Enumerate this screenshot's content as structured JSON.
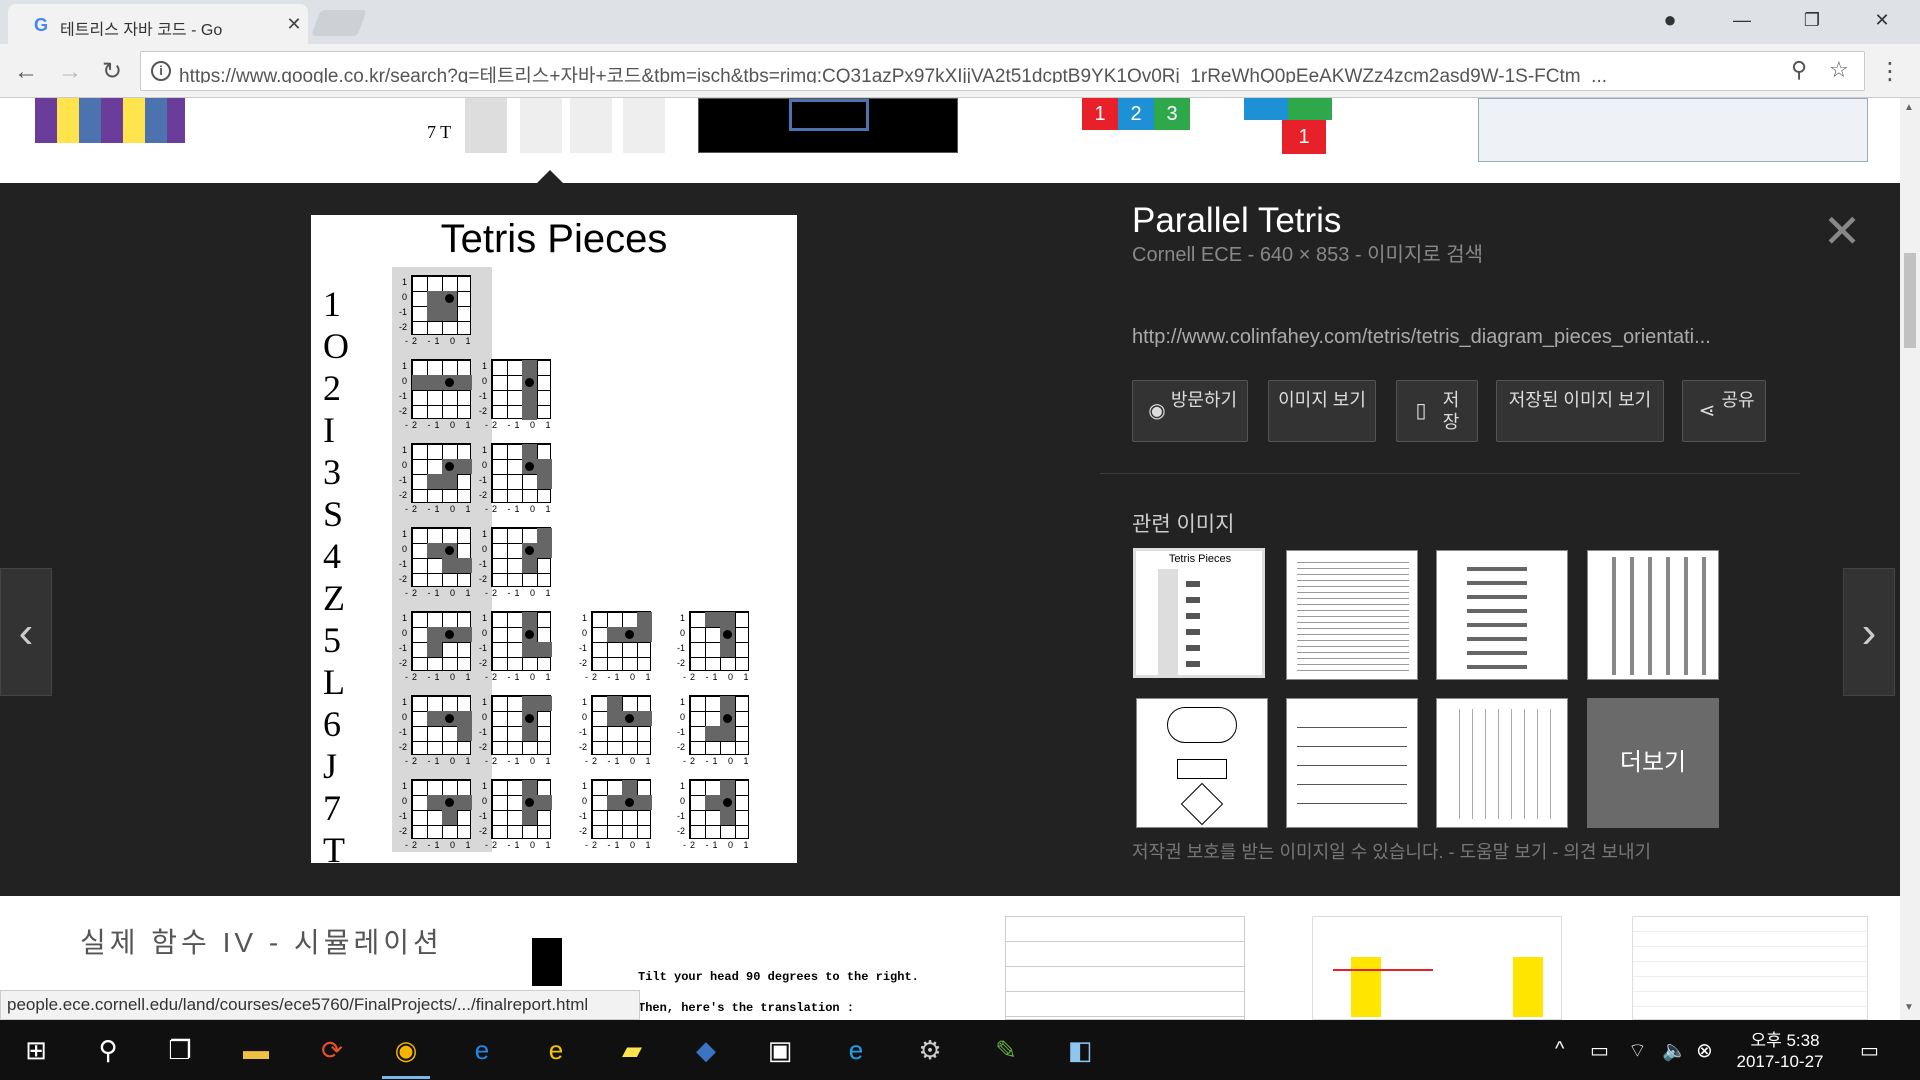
{
  "browser": {
    "tab_title": "테트리스 자바 코드 - Go",
    "tab_favicon": "G",
    "url": "https://www.google.co.kr/search?q=테트리스+자바+코드&tbm=isch&tbs=rimg:CQ31azPx97kXIjjVA2t51dcptB9YK1Ov0Rj_1rReWhQ0pEeAKWZz4zcm2asd9W-1S-FCtm_...",
    "icons": {
      "back": "back-arrow-icon",
      "forward": "forward-arrow-icon",
      "reload": "reload-icon",
      "zoom": "zoom-icon",
      "bookmark": "star-icon",
      "menu": "kebab-menu-icon",
      "profile": "profile-icon"
    },
    "status_url": "people.ece.cornell.edu/land/courses/ece5760/FinalProjects/.../finalreport.html"
  },
  "preview": {
    "title": "Tetris Pieces",
    "rows": [
      {
        "num": "1",
        "letter": "O"
      },
      {
        "num": "2",
        "letter": "I"
      },
      {
        "num": "3",
        "letter": "S"
      },
      {
        "num": "4",
        "letter": "Z"
      },
      {
        "num": "5",
        "letter": "L"
      },
      {
        "num": "6",
        "letter": "J"
      },
      {
        "num": "7",
        "letter": "T"
      }
    ],
    "axis_y": [
      "1",
      "0",
      "-1",
      "-2"
    ],
    "axis_x": "-2 -1  0  1"
  },
  "info": {
    "title": "Parallel Tetris",
    "source": "Cornell ECE - 640 × 853 - 이미지로 검색",
    "url": "http://www.colinfahey.com/tetris/tetris_diagram_pieces_orientati...",
    "buttons": [
      {
        "label": "방문하기",
        "icon": "globe-icon"
      },
      {
        "label": "이미지 보기",
        "icon": ""
      },
      {
        "label": "저장",
        "icon": "bookmark-icon"
      },
      {
        "label": "저장된 이미지 보기",
        "icon": ""
      },
      {
        "label": "공유",
        "icon": "share-icon"
      }
    ],
    "related_title": "관련 이미지",
    "more_label": "더보기",
    "copyright": "저작권 보호를 받는 이미지일 수 있습니다. - 도움말 보기 - 의견 보내기",
    "thumb_caption": "Tetris Pieces"
  },
  "top_strip": {
    "label_7t": "7 T",
    "numbered_1": "1",
    "numbered_2": "2",
    "numbered_3": "3"
  },
  "bottom": {
    "korean_text": "실제 함수 IV - 시뮬레이션",
    "code_line_1": "Tilt your head 90 degrees to the right.",
    "code_line_2": "Then, here's the translation :"
  },
  "taskbar": {
    "time": "오후 5:38",
    "date": "2017-10-27"
  }
}
